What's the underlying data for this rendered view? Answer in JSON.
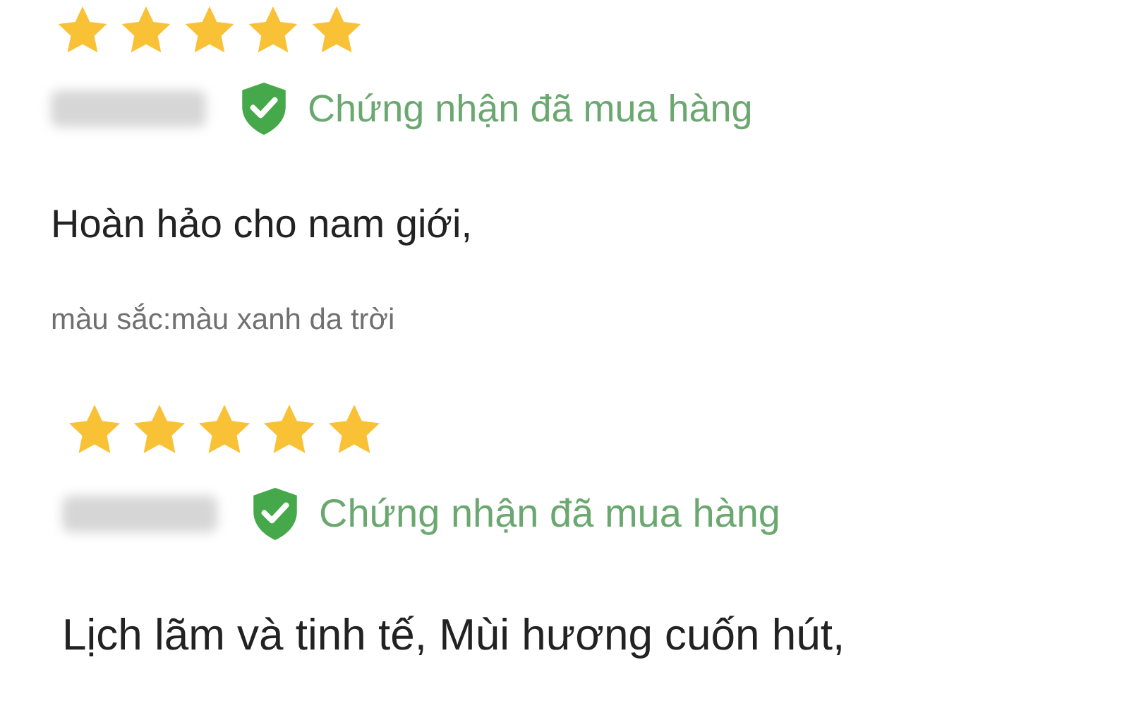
{
  "reviews": [
    {
      "stars": 5,
      "verified": "Chứng nhận đã mua hàng",
      "comment": "Hoàn hảo cho nam giới,",
      "attribute": "màu sắc:màu xanh da trời"
    },
    {
      "stars": 5,
      "verified": "Chứng nhận đã mua hàng",
      "comment": "Lịch lãm và tinh tế, Mùi hương cuốn hút,"
    }
  ]
}
